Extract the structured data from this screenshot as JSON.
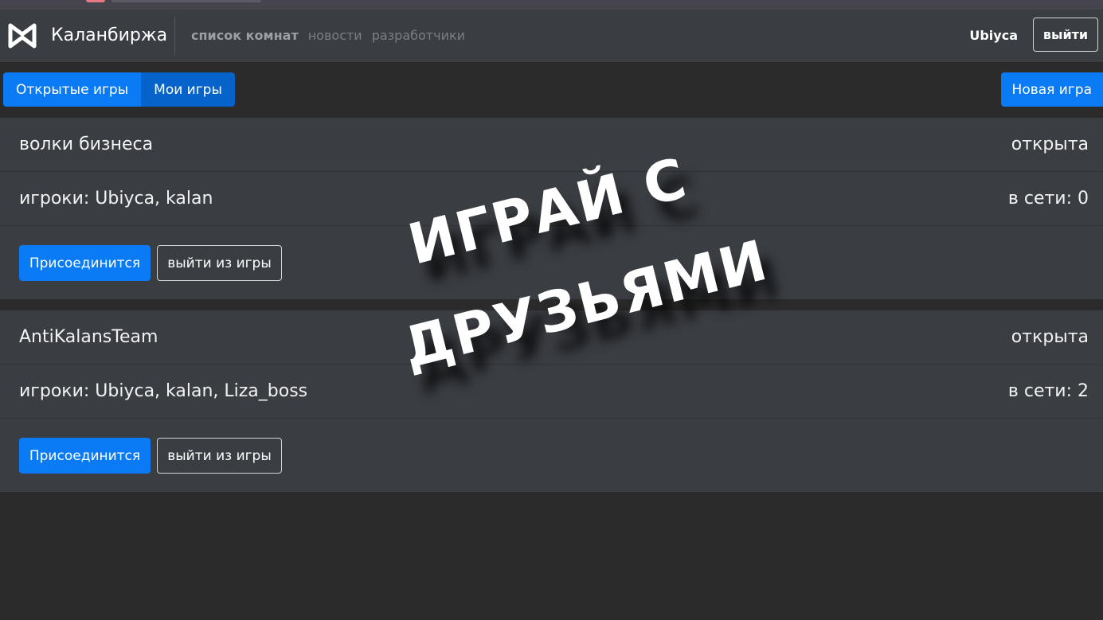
{
  "brand": {
    "name": "Каланбиржа",
    "logo_icon": "bowtie-logo-icon"
  },
  "nav": {
    "active": "список комнат",
    "links": [
      "новости",
      "разработчики"
    ]
  },
  "user": {
    "name": "Ubiyca",
    "logout_label": "выйти"
  },
  "tabs": [
    {
      "label": "Открытые игры"
    },
    {
      "label": "Мои игры"
    }
  ],
  "new_game_label": "Новая игра",
  "games": [
    {
      "name": "волки бизнеса",
      "status": "открыта",
      "players": "игроки: Ubiyca, kalan",
      "online": "в сети: 0",
      "join_label": "Присоединится",
      "leave_label": "выйти из игры"
    },
    {
      "name": "AntiKalansTeam",
      "status": "открыта",
      "players": "игроки: Ubiyca, kalan, Liza_boss",
      "online": "в сети: 2",
      "join_label": "Присоединится",
      "leave_label": "выйти из игры"
    }
  ],
  "overlay": {
    "line1": "ИГРАЙ С",
    "line2": "ДРУЗЬЯМИ"
  },
  "colors": {
    "primary": "#0a7bf5",
    "navbar": "#3a3d42",
    "background": "#2b2b2b"
  }
}
